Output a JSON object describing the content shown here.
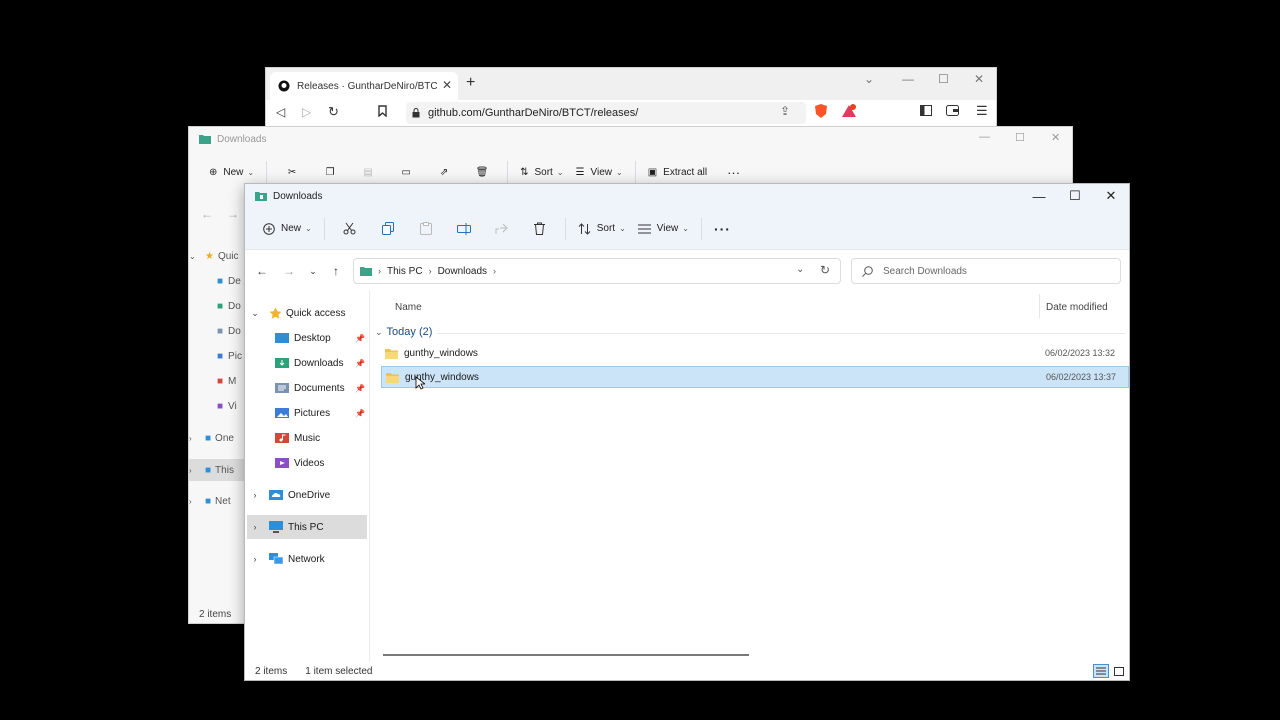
{
  "browser": {
    "tab_title": "Releases · GuntharDeNiro/BTCT",
    "url": "github.com/GuntharDeNiro/BTCT/releases/"
  },
  "back_window": {
    "title": "Downloads",
    "toolbar": {
      "new": "New",
      "sort": "Sort",
      "view": "View",
      "extract_all": "Extract all"
    },
    "sidebar_items": [
      "Quic",
      "De",
      "Do",
      "Do",
      "Pic",
      "M",
      "Vi",
      "One",
      "This",
      "Net"
    ],
    "status": "2 items"
  },
  "window": {
    "title": "Downloads",
    "toolbar": {
      "new": "New",
      "sort": "Sort",
      "view": "View",
      "more": "···"
    },
    "address": {
      "crumbs": [
        "This PC",
        "Downloads"
      ]
    },
    "search": {
      "placeholder": "Search Downloads"
    },
    "sidebar": {
      "quick_access": "Quick access",
      "items": [
        {
          "label": "Desktop",
          "icon": "desktop-folder-icon",
          "color": "#2f8fd6"
        },
        {
          "label": "Downloads",
          "icon": "downloads-folder-icon",
          "color": "#2aa37a"
        },
        {
          "label": "Documents",
          "icon": "documents-folder-icon",
          "color": "#7b93b0"
        },
        {
          "label": "Pictures",
          "icon": "pictures-folder-icon",
          "color": "#3d7bd8"
        },
        {
          "label": "Music",
          "icon": "music-folder-icon",
          "color": "#d2493b"
        },
        {
          "label": "Videos",
          "icon": "videos-folder-icon",
          "color": "#8a4fc4"
        }
      ],
      "onedrive": "OneDrive",
      "this_pc": "This PC",
      "network": "Network"
    },
    "columns": {
      "name": "Name",
      "date_modified": "Date modified"
    },
    "group": {
      "label": "Today (2)"
    },
    "files": [
      {
        "name": "gunthy_windows",
        "date": "06/02/2023 13:32",
        "selected": false
      },
      {
        "name": "gunthy_windows",
        "date": "06/02/2023 13:37",
        "selected": true
      }
    ],
    "status": {
      "count": "2 items",
      "selection": "1 item selected"
    }
  },
  "colors": {
    "folder": "#f2c14e",
    "selection": "#cce4f7",
    "titlebar": "#eef4f9"
  }
}
